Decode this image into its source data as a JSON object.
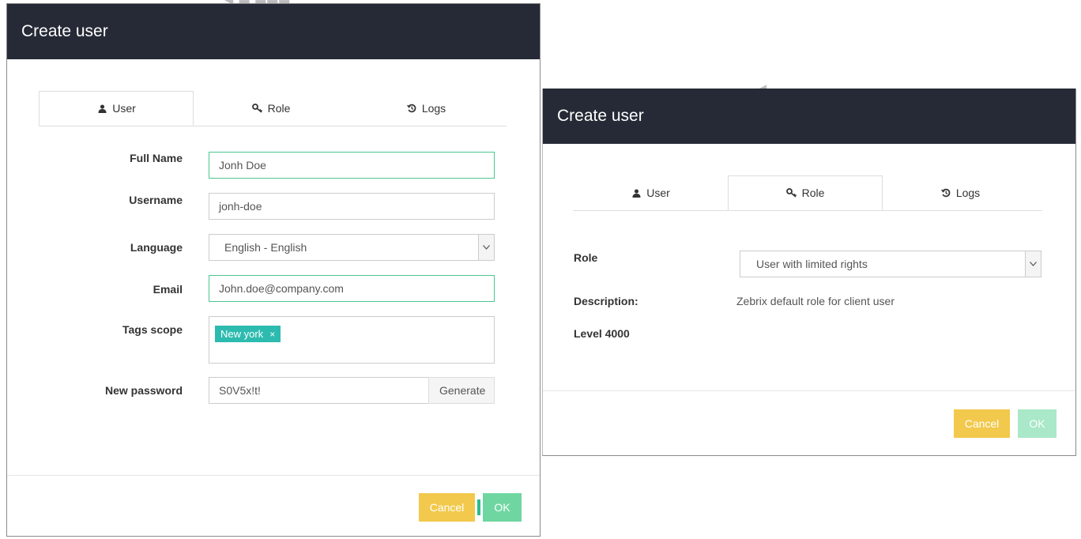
{
  "left_dialog": {
    "title": "Create user",
    "tabs": [
      {
        "label": "User",
        "icon": "user-icon"
      },
      {
        "label": "Role",
        "icon": "key-icon"
      },
      {
        "label": "Logs",
        "icon": "history-icon"
      }
    ],
    "active_tab": "User",
    "fields": {
      "full_name": {
        "label": "Full Name",
        "value": "Jonh Doe"
      },
      "username": {
        "label": "Username",
        "value": "jonh-doe"
      },
      "language": {
        "label": "Language",
        "value": "English - English"
      },
      "email": {
        "label": "Email",
        "value": "John.doe@company.com"
      },
      "tags_scope": {
        "label": "Tags scope",
        "tags": [
          "New york"
        ],
        "remove_glyph": "×"
      },
      "new_password": {
        "label": "New password",
        "value": "S0V5x!t!",
        "generate_label": "Generate"
      }
    },
    "cancel_label": "Cancel",
    "ok_label": "OK"
  },
  "right_dialog": {
    "title": "Create user",
    "tabs": [
      {
        "label": "User",
        "icon": "user-icon"
      },
      {
        "label": "Role",
        "icon": "key-icon"
      },
      {
        "label": "Logs",
        "icon": "history-icon"
      }
    ],
    "active_tab": "Role",
    "role": {
      "label": "Role",
      "value": "User with limited rights"
    },
    "description": {
      "label": "Description:",
      "value": "Zebrix default role for client user"
    },
    "level": "Level 4000",
    "cancel_label": "Cancel",
    "ok_label": "OK"
  },
  "colors": {
    "header_bg": "#252a36",
    "focus_border": "#4cc790",
    "tag_bg": "#2dbbb0",
    "cancel_bg": "#f2c94c",
    "ok_bg": "#6fd6a2"
  }
}
